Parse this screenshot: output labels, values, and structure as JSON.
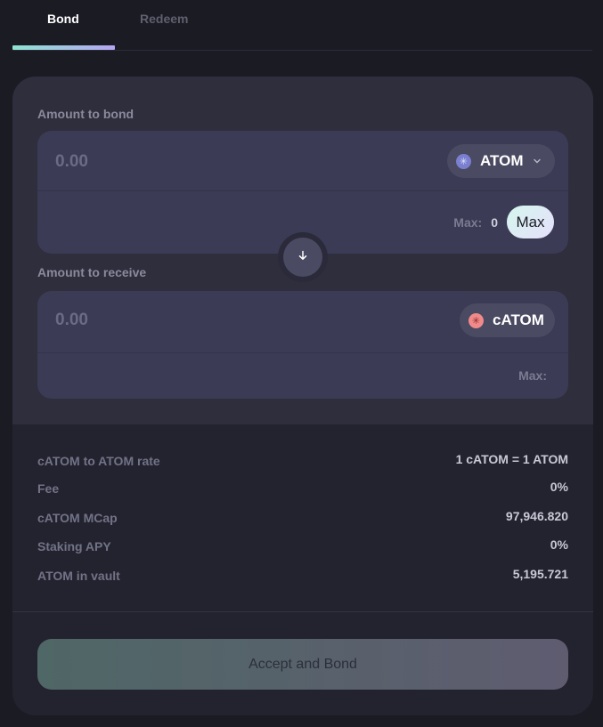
{
  "tabs": {
    "bond": "Bond",
    "redeem": "Redeem",
    "active": "bond"
  },
  "bond_field": {
    "label": "Amount to bond",
    "placeholder": "0.00",
    "token": "ATOM",
    "max_label": "Max:",
    "max_value": "0",
    "max_button": "Max"
  },
  "receive_field": {
    "label": "Amount to receive",
    "placeholder": "0.00",
    "token": "cATOM",
    "max_label": "Max:"
  },
  "stats": [
    {
      "label": "cATOM to ATOM rate",
      "value": "1 cATOM = 1 ATOM"
    },
    {
      "label": "Fee",
      "value": "0%"
    },
    {
      "label": "cATOM MCap",
      "value": "97,946.820"
    },
    {
      "label": "Staking APY",
      "value": "0%"
    },
    {
      "label": "ATOM in vault",
      "value": "5,195.721"
    }
  ],
  "action": {
    "label": "Accept and Bond"
  },
  "icons": {
    "atom": "atom-token-icon",
    "catom": "catom-token-icon",
    "swap": "arrow-down-icon",
    "dropdown": "chevron-down-icon"
  },
  "colors": {
    "accent_start": "#8fe3d2",
    "accent_end": "#b6a4f2",
    "catom": "#f08a8a",
    "atom": "#7a7fd0"
  }
}
